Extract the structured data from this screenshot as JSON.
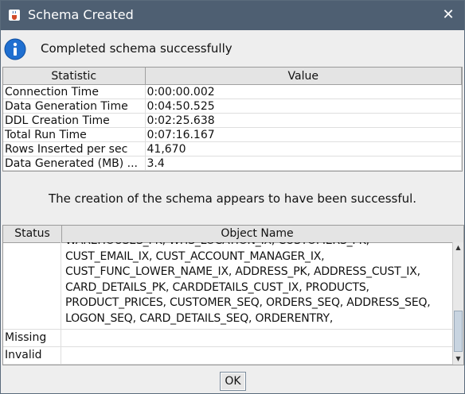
{
  "window": {
    "title": "Schema Created",
    "app_icon": "java-cup-icon",
    "close_symbol": "✕"
  },
  "info": {
    "icon": "info-icon",
    "message": "Completed schema successfully"
  },
  "statistics": {
    "headers": [
      "Statistic",
      "Value"
    ],
    "rows": [
      {
        "statistic": "Connection Time",
        "value": "0:00:00.002"
      },
      {
        "statistic": "Data Generation Time",
        "value": "0:04:50.525"
      },
      {
        "statistic": "DDL Creation Time",
        "value": "0:02:25.638"
      },
      {
        "statistic": "Total Run Time",
        "value": "0:07:16.167"
      },
      {
        "statistic": "Rows Inserted per sec",
        "value": "41,670"
      },
      {
        "statistic": "Data Generated (MB) ...",
        "value": "3.4"
      }
    ]
  },
  "success_message": "The creation of the schema appears to have been successful.",
  "objects": {
    "headers": [
      "Status",
      "Object Name"
    ],
    "valid_lines": [
      "WAREHOUSES_PK, WHS_LOCATION_IX, CUSTOMERS_PK,",
      "CUST_EMAIL_IX, CUST_ACCOUNT_MANAGER_IX,",
      "CUST_FUNC_LOWER_NAME_IX, ADDRESS_PK, ADDRESS_CUST_IX,",
      "CARD_DETAILS_PK, CARDDETAILS_CUST_IX, PRODUCTS,",
      "PRODUCT_PRICES, CUSTOMER_SEQ, ORDERS_SEQ, ADDRESS_SEQ,",
      "LOGON_SEQ, CARD_DETAILS_SEQ, ORDERENTRY,"
    ],
    "missing_label": "Missing",
    "invalid_label": "Invalid",
    "missing_value": "",
    "invalid_value": ""
  },
  "buttons": {
    "ok_label": "OK"
  },
  "colors": {
    "titlebar": "#4e5f72",
    "background": "#eeeeee",
    "info_blue": "#1f6fd0"
  }
}
